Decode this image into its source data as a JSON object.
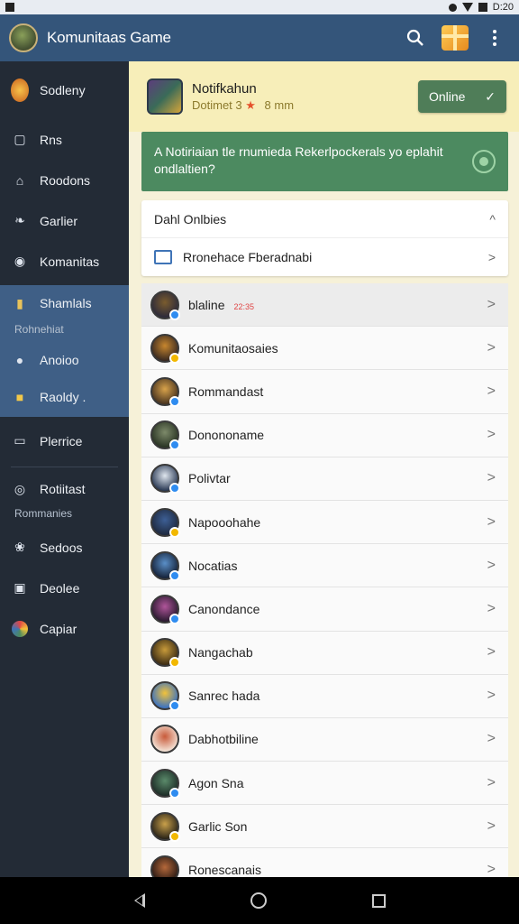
{
  "status": {
    "time": "D:20"
  },
  "appbar": {
    "title": "Komunitaas Game",
    "search_icon": "search-icon",
    "gift_icon": "gift-icon",
    "menu_icon": "more-vert-icon"
  },
  "sidebar": {
    "items": [
      {
        "label": "Sodleny",
        "icon": "profile-avatar-icon"
      },
      {
        "label": "Rns",
        "icon": "tv-icon"
      },
      {
        "label": "Roodons",
        "icon": "home-icon"
      },
      {
        "label": "Garlier",
        "icon": "twitter-icon"
      },
      {
        "label": "Komanitas",
        "icon": "community-icon"
      },
      {
        "label": "Shamlals",
        "icon": "stats-icon",
        "sub": "Rohnehiat"
      },
      {
        "label": "Anoioo",
        "icon": "location-icon"
      },
      {
        "label": "Raoldy .",
        "icon": "book-icon"
      },
      {
        "label": "Plerrice",
        "icon": "phone-icon"
      },
      {
        "label": "Rotiitast",
        "icon": "target-icon",
        "sub": "Rommanies"
      },
      {
        "label": "Sedoos",
        "icon": "puzzle-icon"
      },
      {
        "label": "Deolee",
        "icon": "news-icon"
      },
      {
        "label": "Capiar",
        "icon": "color-wheel-icon"
      }
    ]
  },
  "notification": {
    "title": "Notifkahun",
    "subtitle": "Dotimet 3",
    "subtitle_star": "★",
    "subtitle_time": "8 mm",
    "online_label": "Online",
    "online_check": "✓"
  },
  "banner": {
    "text": "A  Notiriaian tle rnumieda Rekerlpockerals yo eplahit ondlaltien?"
  },
  "card": {
    "header": "Dahl Onlbies",
    "header_chev": "^",
    "row_label": "Rronehace Fberadnabi",
    "row_chev": ">"
  },
  "list": [
    {
      "label": "blaline",
      "tag": "22:35",
      "colors": [
        "#7a5c2e",
        "#2d2a3a"
      ],
      "badge": "blue"
    },
    {
      "label": "Komunitaosaies",
      "colors": [
        "#c7862e",
        "#3a2a20"
      ],
      "badge": "gold"
    },
    {
      "label": "Rommandast",
      "colors": [
        "#d8a24a",
        "#4a3520"
      ],
      "badge": "blue"
    },
    {
      "label": "Donononame",
      "colors": [
        "#7d8a6a",
        "#2a3524"
      ],
      "badge": "blue"
    },
    {
      "label": "Polivtar",
      "colors": [
        "#dfe6ee",
        "#2b3a55"
      ],
      "badge": "blue"
    },
    {
      "label": "Napooohahe",
      "colors": [
        "#3d5f95",
        "#1f2a40"
      ],
      "badge": "gold"
    },
    {
      "label": "Nocatias",
      "colors": [
        "#5a8fc8",
        "#16233a"
      ],
      "badge": "blue"
    },
    {
      "label": "Canondance",
      "colors": [
        "#b0559a",
        "#2a1a30"
      ],
      "badge": "blue"
    },
    {
      "label": "Nangachab",
      "colors": [
        "#c79a3a",
        "#3d2d14"
      ],
      "badge": "gold"
    },
    {
      "label": "Sanrec hada",
      "colors": [
        "#f2c23a",
        "#3a72c2"
      ],
      "badge": "blue"
    },
    {
      "label": "Dabhotbiline",
      "colors": [
        "#c85a3a",
        "#f4e3d6"
      ],
      "badge": "none"
    },
    {
      "label": "Agon Sna",
      "colors": [
        "#5a8a6a",
        "#1e2e28"
      ],
      "badge": "blue"
    },
    {
      "label": "Garlic Son",
      "colors": [
        "#c9a04a",
        "#2a2418"
      ],
      "badge": "gold"
    },
    {
      "label": "Ronescanais",
      "colors": [
        "#b5683a",
        "#2a1a14"
      ],
      "badge": "none"
    }
  ],
  "list_chev": ">",
  "navbar": {
    "back_icon": "back-icon",
    "home_icon": "home-circle-icon",
    "recents_icon": "recents-icon"
  }
}
